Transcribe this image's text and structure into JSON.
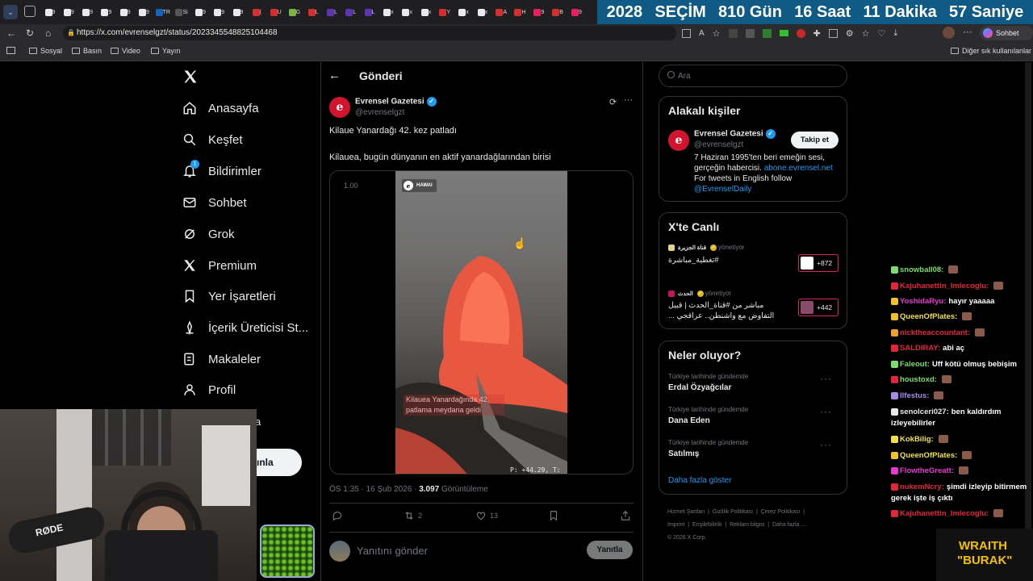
{
  "tabs": [
    "9",
    "9",
    "9",
    "9",
    "9",
    "9",
    "TR",
    "Si",
    "9",
    "9",
    "9",
    "(",
    "U",
    "G",
    "L",
    "L",
    "L",
    "L",
    "x",
    "x",
    "x",
    "Y",
    "x",
    "x",
    "A",
    "H",
    "9",
    "B",
    "9"
  ],
  "countdown": {
    "year": "2028",
    "event": "SEÇİM",
    "days": "810 Gün",
    "hours": "16 Saat",
    "minutes": "11 Dakika",
    "seconds": "57 Saniye"
  },
  "browser": {
    "url": "https://x.com/evrenselgzt/status/2023345548825104468",
    "profile_label": "Sohbet et",
    "bookmarks": [
      "Sosyal",
      "Basın",
      "Video",
      "Yayın"
    ],
    "other_bookmarks": "Diğer sık kullanılanlar"
  },
  "nav": {
    "items": [
      "Anasayfa",
      "Keşfet",
      "Bildirimler",
      "Sohbet",
      "Grok",
      "Premium",
      "Yer İşaretleri",
      "İçerik Üreticisi St...",
      "Makaleler",
      "Profil"
    ],
    "notif_count": "1",
    "partial_more": "a",
    "post_button": "ınla"
  },
  "post": {
    "header": "Gönderi",
    "author": "Evrensel Gazetesi",
    "handle": "@evrenselgzt",
    "text1": "Kilaue Yanardağı 42. kez patladı",
    "text2": "Kilauea, bugün dünyanın en aktif yanardağlarından birisi",
    "video_tag": "HAWAI",
    "video_speed": "1.00",
    "video_caption": "Kilauea Yanardağında 42. patlama meydana geldi",
    "video_hud": "P: +44.29, T:",
    "timestamp": "ÖS 1:35 · 16 Şub 2026 · ",
    "views": "3.097",
    "views_label": " Görüntüleme",
    "replies": "",
    "reposts": "2",
    "likes": "13",
    "reply_placeholder": "Yanıtını gönder",
    "reply_button": "Yanıtla"
  },
  "search": {
    "placeholder": "Ara"
  },
  "related": {
    "title": "Alakalı kişiler",
    "name": "Evrensel Gazetesi",
    "handle": "@evrenselgzt",
    "follow": "Takip et",
    "bio_line1": "7 Haziran 1995'ten beri emeğin sesi,",
    "bio_line2_a": "gerçeğin habercisi. ",
    "bio_link": "abone.evrensel.net",
    "bio_line3": "For tweets in English follow",
    "bio_mention": "@EvrenselDaily"
  },
  "live": {
    "title": "X'te Canlı",
    "items": [
      {
        "host": "قناة الجزيرة",
        "role": "yönetiyor",
        "text": "#تغطية_مباشرة",
        "count": "+872"
      },
      {
        "host": "الحدث",
        "role": "yönetiyor",
        "text": "مباشر من #قناة_الحدث | قبيل التفاوض مع واشنطن.. عراقجي ...",
        "count": "+442"
      }
    ]
  },
  "trends": {
    "title": "Neler oluyor?",
    "items": [
      {
        "context": "Türkiye tarihinde gündemde",
        "name": "Erdal Özyağcılar"
      },
      {
        "context": "Türkiye tarihinde gündemde",
        "name": "Dana Eden"
      },
      {
        "context": "Türkiye tarihinde gündemde",
        "name": "Satılmış"
      }
    ],
    "more": "Daha fazla göster"
  },
  "footer": {
    "links": [
      "Hizmet Şartları",
      "Gizlilik Politikası",
      "Çerez Politikası",
      "Imprint",
      "Erişilebilirlik",
      "Reklam bilgisi",
      "Daha fazla ..."
    ],
    "copyright": "© 2026 X Corp."
  },
  "chat": [
    {
      "user": "snowball08:",
      "msg": "",
      "color": "#7ddc6e"
    },
    {
      "user": "Kajuhanettin_Imlecoglu:",
      "msg": "",
      "color": "#e0263b"
    },
    {
      "user": "YoshidaRyu:",
      "msg": "hayır yaaaaa",
      "color": "#e53ad0"
    },
    {
      "user": "QueenOfPlates:",
      "msg": "",
      "color": "#f0e04a"
    },
    {
      "user": "nicktheaccountant:",
      "msg": "",
      "color": "#e0263b"
    },
    {
      "user": "SALDIRAY:",
      "msg": "abi aç",
      "color": "#e0263b"
    },
    {
      "user": "Faleout:",
      "msg": "Uff kötü olmuş bebişim",
      "color": "#7ddc6e"
    },
    {
      "user": "houstoxd:",
      "msg": "",
      "color": "#7ddc6e"
    },
    {
      "user": "llfestus:",
      "msg": "",
      "color": "#a58be8"
    },
    {
      "user": "senolceri027:",
      "msg": "ben kaldırdım izleyebilirler",
      "color": "#e7e9ea"
    },
    {
      "user": "KokBilig:",
      "msg": "",
      "color": "#f0e04a"
    },
    {
      "user": "QueenOfPlates:",
      "msg": "",
      "color": "#f0e04a"
    },
    {
      "user": "FlowtheGreatt:",
      "msg": "",
      "color": "#e53ad0"
    },
    {
      "user": "nukemNcry:",
      "msg": "şimdi izleyip bitirmem gerek işte iş çıktı",
      "color": "#e0263b"
    },
    {
      "user": "Kajuhanettin_Imlecoglu:",
      "msg": "",
      "color": "#e0263b"
    }
  ],
  "overlay": {
    "brand_line1": "WRAITH",
    "brand_line2": "\"BURAK\"",
    "mic_brand": "RØDE"
  }
}
